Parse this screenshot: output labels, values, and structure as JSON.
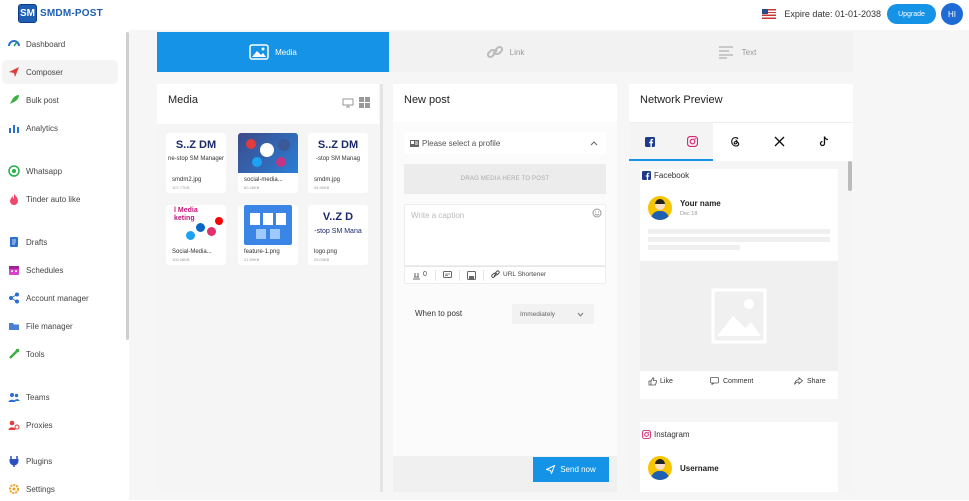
{
  "app": {
    "logo_badge": "SM",
    "logo_text": "SMDM-POST"
  },
  "topbar": {
    "expire": "Expire date: 01-01-2038",
    "upgrade": "Upgrade",
    "user_initials": "HI"
  },
  "sidebar": {
    "items": [
      {
        "label": "Dashboard",
        "icon": "dashboard-icon"
      },
      {
        "label": "Composer",
        "icon": "paper-plane-icon",
        "active": true
      },
      {
        "label": "Bulk post",
        "icon": "rocket-icon"
      },
      {
        "label": "Analytics",
        "icon": "bar-chart-icon"
      },
      {
        "label": "Whatsapp",
        "icon": "whatsapp-icon"
      },
      {
        "label": "Tinder auto like",
        "icon": "flame-icon"
      },
      {
        "label": "Drafts",
        "icon": "drafts-icon"
      },
      {
        "label": "Schedules",
        "icon": "calendar-icon"
      },
      {
        "label": "Account manager",
        "icon": "share-nodes-icon"
      },
      {
        "label": "File manager",
        "icon": "folder-icon"
      },
      {
        "label": "Tools",
        "icon": "tools-icon"
      },
      {
        "label": "Teams",
        "icon": "team-icon"
      },
      {
        "label": "Proxies",
        "icon": "proxy-icon"
      },
      {
        "label": "Plugins",
        "icon": "plugin-icon"
      },
      {
        "label": "Settings",
        "icon": "settings-icon"
      }
    ]
  },
  "tabs": [
    {
      "label": "Media",
      "active": true
    },
    {
      "label": "Link"
    },
    {
      "label": "Text"
    }
  ],
  "media": {
    "title": "Media",
    "files": [
      {
        "name": "smdm2.jpg",
        "size": "107.77KB",
        "art_line1": "S..Z DM",
        "art_line2": "ne-stop SM Manager"
      },
      {
        "name": "social-media...",
        "size": "60.26KB"
      },
      {
        "name": "smdm.jpg",
        "size": "94.95KB",
        "art_line1": "S..Z DM",
        "art_line2": "-stop SM Manag"
      },
      {
        "name": "Social-Media...",
        "size": "100.06KB",
        "art_line1": "l Media",
        "art_line2": "keting"
      },
      {
        "name": "feature-1.png",
        "size": "21.59KB"
      },
      {
        "name": "logo.png",
        "size": "25.03KB",
        "art_line1": "V..Z D",
        "art_line2": "-stop SM Mana"
      }
    ]
  },
  "post": {
    "title": "New post",
    "profile_placeholder": "Please select a profile",
    "drop_text": "DRAG MEDIA HERE TO POST",
    "caption_placeholder": "Write a caption",
    "counter": "0",
    "url_shortener": "URL Shortener",
    "when_label": "When to post",
    "when_value": "Immediately",
    "send": "Send now"
  },
  "preview": {
    "title": "Network Preview",
    "networks": [
      "facebook-icon",
      "instagram-icon",
      "threads-icon",
      "x-icon",
      "tiktok-icon"
    ],
    "facebook": {
      "label": "Facebook",
      "name": "Your name",
      "date": "Dec 18",
      "like": "Like",
      "comment": "Comment",
      "share": "Share"
    },
    "instagram": {
      "label": "Instagram",
      "name": "Username"
    }
  },
  "colors": {
    "accent": "#1593e6",
    "brand": "#1e5fb4"
  }
}
